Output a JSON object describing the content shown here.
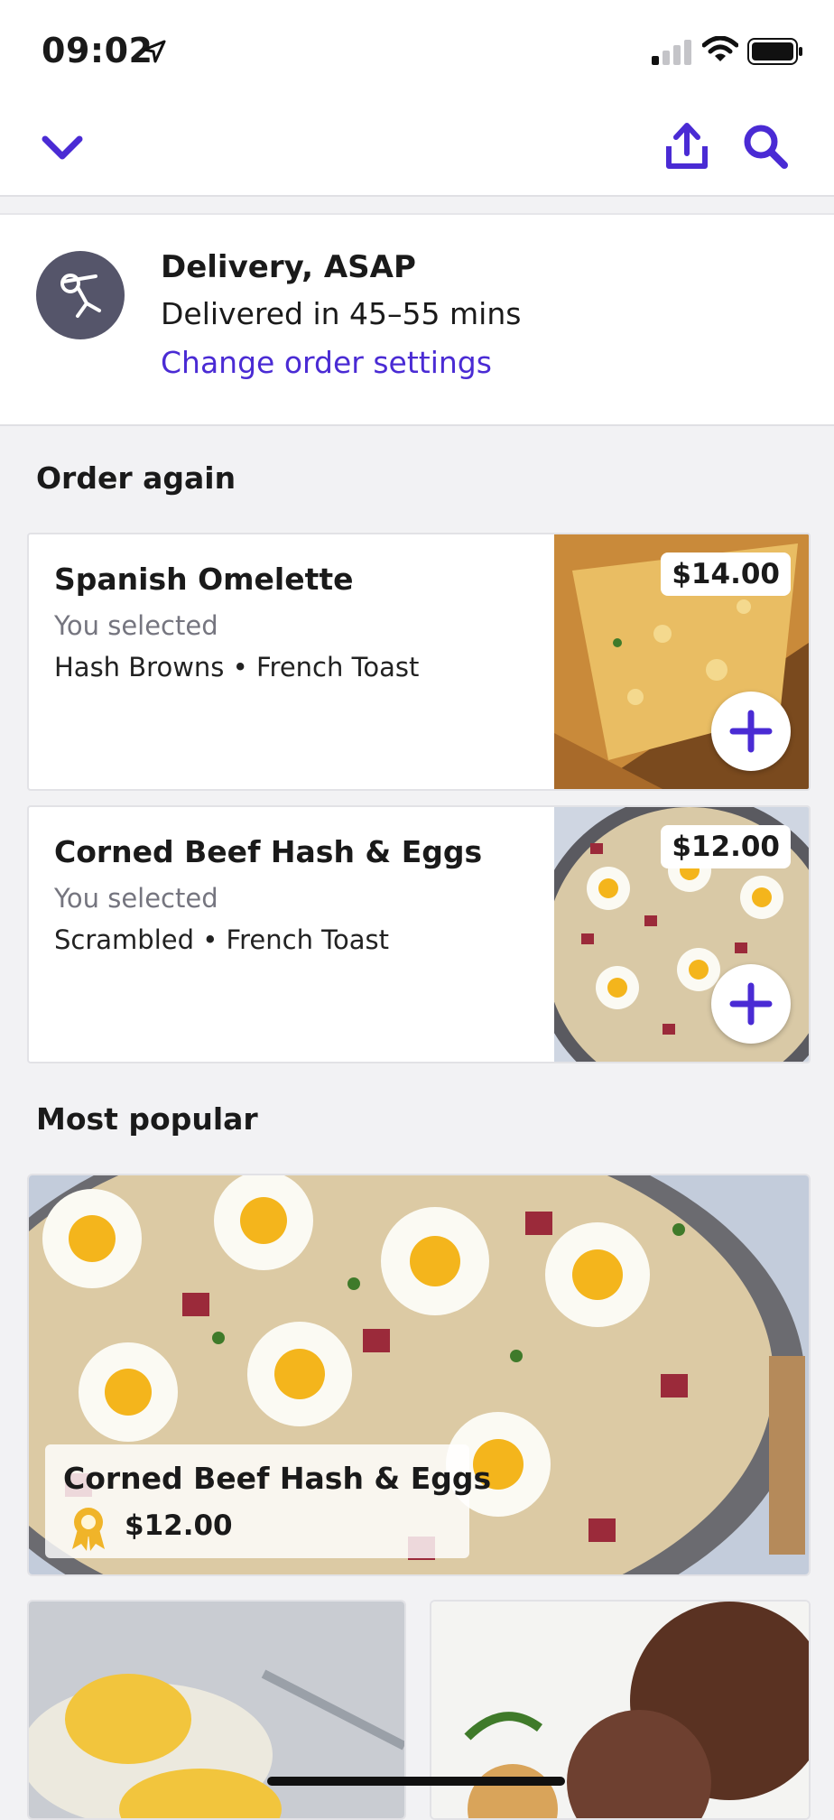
{
  "status_bar": {
    "time": "09:02"
  },
  "header": {
    "icons": [
      "chevron-down-icon",
      "share-icon",
      "search-icon"
    ]
  },
  "order_settings": {
    "title": "Delivery, ASAP",
    "eta": "Delivered in 45–55 mins",
    "change_link": "Change order settings"
  },
  "order_again": {
    "heading": "Order again",
    "items": [
      {
        "name": "Spanish Omelette",
        "selected_label": "You selected",
        "options": "Hash Browns • French Toast",
        "price": "$14.00"
      },
      {
        "name": "Corned Beef Hash & Eggs",
        "selected_label": "You selected",
        "options": "Scrambled • French Toast",
        "price": "$12.00"
      }
    ]
  },
  "most_popular": {
    "heading": "Most popular",
    "featured": {
      "name": "Corned Beef Hash & Eggs",
      "price": "$12.00"
    }
  },
  "colors": {
    "accent": "#4a2bd4",
    "medal": "#f0b429"
  }
}
